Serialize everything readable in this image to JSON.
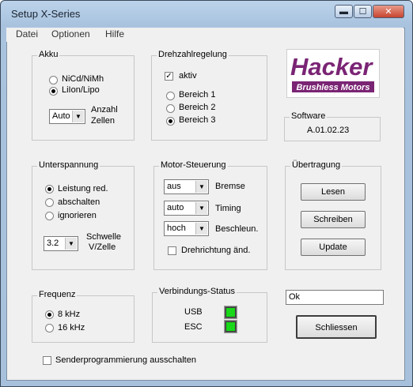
{
  "window": {
    "title": "Setup X-Series"
  },
  "menu": [
    "Datei",
    "Optionen",
    "Hilfe"
  ],
  "akku": {
    "title": "Akku",
    "options": [
      "NiCd/NiMh",
      "LiIon/Lipo"
    ],
    "selected": "LiIon/Lipo",
    "combo_value": "Auto",
    "combo_label_1": "Anzahl",
    "combo_label_2": "Zellen"
  },
  "drehzahl": {
    "title": "Drehzahlregelung",
    "active_label": "aktiv",
    "active_checked": true,
    "options": [
      "Bereich 1",
      "Bereich 2",
      "Bereich 3"
    ],
    "selected": "Bereich 3"
  },
  "logo": {
    "brand": "Hacker",
    "tagline": "Brushless Motors"
  },
  "software": {
    "title": "Software",
    "version": "A.01.02.23"
  },
  "unterspannung": {
    "title": "Unterspannung",
    "options": [
      "Leistung red.",
      "abschalten",
      "ignorieren"
    ],
    "selected": "Leistung red.",
    "combo_value": "3.2",
    "combo_label_1": "Schwelle",
    "combo_label_2": "V/Zelle"
  },
  "motor": {
    "title": "Motor-Steuerung",
    "bremse_value": "aus",
    "bremse_label": "Bremse",
    "timing_value": "auto",
    "timing_label": "Timing",
    "beschleun_value": "hoch",
    "beschleun_label": "Beschleun.",
    "drehrichtung_label": "Drehrichtung änd.",
    "drehrichtung_checked": false
  },
  "uebertragung": {
    "title": "Übertragung",
    "lesen": "Lesen",
    "schreiben": "Schreiben",
    "update": "Update"
  },
  "frequenz": {
    "title": "Frequenz",
    "options": [
      "8 kHz",
      "16 kHz"
    ],
    "selected": "8 kHz"
  },
  "verbindung": {
    "title": "Verbindungs-Status",
    "usb_label": "USB",
    "esc_label": "ESC",
    "led_color": "#19d819"
  },
  "status_text": "Ok",
  "close_button": "Schliessen",
  "sender_label": "Senderprogrammierung ausschalten",
  "sender_checked": false
}
